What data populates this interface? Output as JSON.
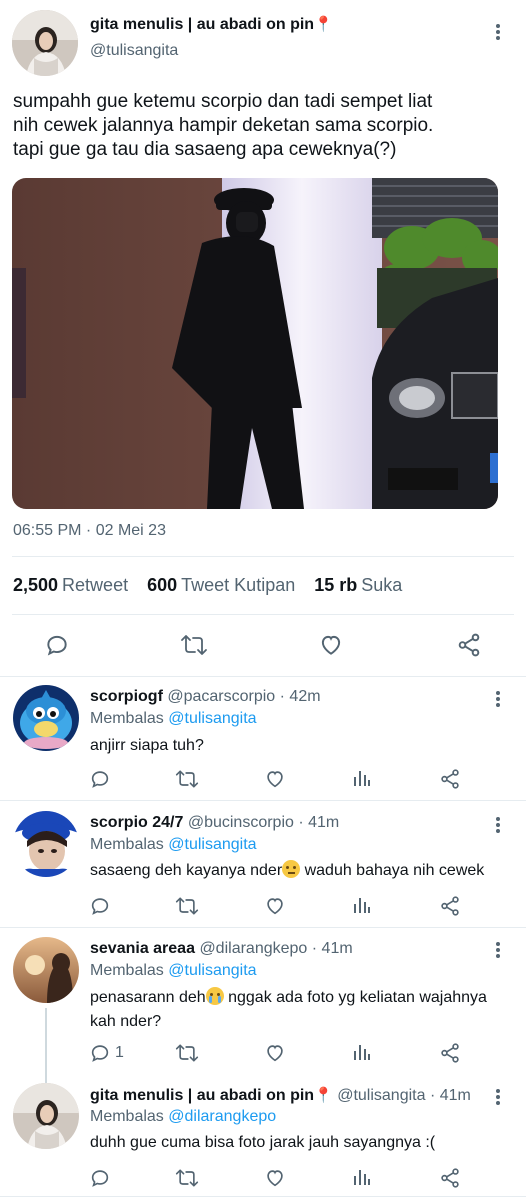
{
  "main_tweet": {
    "author_name": "gita menulis | au abadi on pin",
    "author_handle": "@tulisangita",
    "text_lines": [
      "sumpahh gue ketemu scorpio dan tadi sempet liat",
      "nih cewek jalannya hampir deketan sama scorpio.",
      "tapi gue ga tau dia sasaeng apa ceweknya(?)"
    ],
    "timestamp": "06:55 PM · 02 Mei 23",
    "stats": [
      {
        "value": "2,500",
        "label": "Retweet"
      },
      {
        "value": "600",
        "label": "Tweet Kutipan"
      },
      {
        "value": "15 rb",
        "label": "Suka"
      }
    ]
  },
  "replies": [
    {
      "name": "scorpiogf",
      "handle": "@pacarscorpio",
      "time": "· 42m",
      "replying_prefix": "Membalas",
      "replying_to": "@tulisangita",
      "text": "anjirr siapa tuh?",
      "reply_count": ""
    },
    {
      "name": "scorpio 24/7",
      "handle": "@bucinscorpio",
      "time": "· 41m",
      "replying_prefix": "Membalas",
      "replying_to": "@tulisangita",
      "text_before_emoji": "sasaeng deh kayanya nder",
      "text_after_emoji": " waduh bahaya nih cewek",
      "reply_count": ""
    },
    {
      "name": "sevania areaa",
      "handle": "@dilarangkepo",
      "time": "· 41m",
      "replying_prefix": "Membalas",
      "replying_to": "@tulisangita",
      "text_before_emoji": "penasarann deh",
      "text_after_emoji": " nggak ada foto yg keliatan wajahnya",
      "text_line2": "kah nder?",
      "reply_count": "1"
    },
    {
      "name": "gita menulis | au abadi on pin",
      "handle": "@tulisangita",
      "time": "· 41m",
      "replying_prefix": "Membalas",
      "replying_to": "@dilarangkepo",
      "text": "duhh gue cuma bisa foto jarak jauh sayangnya :(",
      "reply_count": ""
    }
  ],
  "icons": {
    "reply": "reply-icon",
    "retweet": "retweet-icon",
    "like": "heart-icon",
    "analytics": "analytics-icon",
    "share": "share-icon",
    "more": "more-icon",
    "pin_emoji": "pin-emoji"
  },
  "colors": {
    "accent": "#1d9bf0",
    "muted": "#536471",
    "text": "#0f1419",
    "divider": "#e6ecf0"
  }
}
